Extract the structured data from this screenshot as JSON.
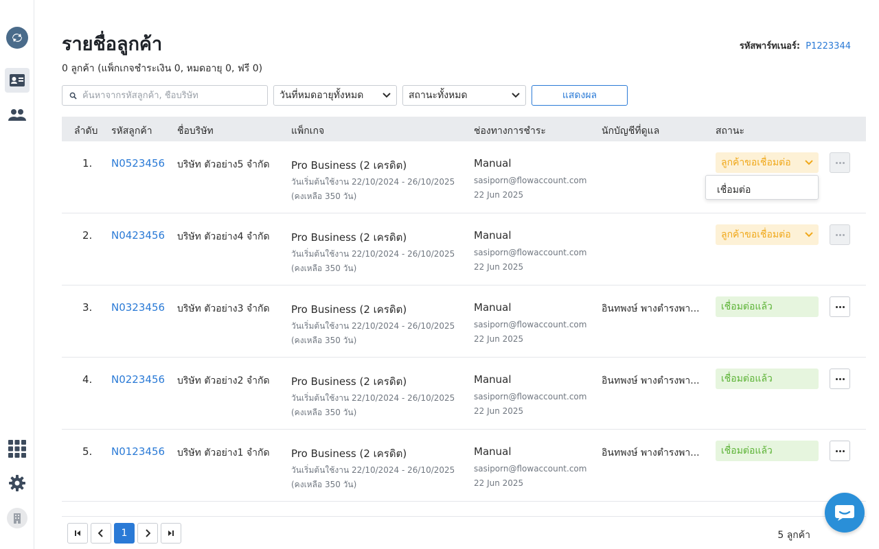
{
  "page": {
    "title": "รายชื่อลูกค้า",
    "subtitle": "0 ลูกค้า (แพ็กเกจชำระเงิน 0, หมดอายุ 0, ฟรี 0)",
    "partner_label": "รหัสพาร์ทเนอร์:",
    "partner_code": "P1223344"
  },
  "filters": {
    "search_placeholder": "ค้นหาจากรหัสลูกค้า, ชื่อบริษัท",
    "expire_select": "วันที่หมดอายุทั้งหมด",
    "status_select": "สถานะทั้งหมด",
    "show_button": "แสดงผล"
  },
  "table": {
    "headers": [
      "ลำดับ",
      "รหัสลูกค้า",
      "ชื่อบริษัท",
      "แพ็กเกจ",
      "ช่องทางการชำระ",
      "นักบัญชีที่ดูแล",
      "สถานะ"
    ],
    "rows": [
      {
        "idx": "1.",
        "code": "N0523456",
        "company": "บริษัท ตัวอย่าง5 จำกัด",
        "package": "Pro Business (2 เครดิต)",
        "dates": "วันเริ่มต้นใช้งาน 22/10/2024 - 26/10/2025",
        "remain": "(คงเหลือ 350 วัน)",
        "payment": "Manual",
        "email": "sasiporn@flowaccount.com",
        "pay_date": "22 Jun 2025",
        "accountant": "",
        "status": "ลูกค้าขอเชื่อมต่อ"
      },
      {
        "idx": "2.",
        "code": "N0423456",
        "company": "บริษัท ตัวอย่าง4 จำกัด",
        "package": "Pro Business (2 เครดิต)",
        "dates": "วันเริ่มต้นใช้งาน 22/10/2024 - 26/10/2025",
        "remain": "(คงเหลือ 350 วัน)",
        "payment": "Manual",
        "email": "sasiporn@flowaccount.com",
        "pay_date": "22 Jun 2025",
        "accountant": "",
        "status": "ลูกค้าขอเชื่อมต่อ"
      },
      {
        "idx": "3.",
        "code": "N0323456",
        "company": "บริษัท ตัวอย่าง3 จำกัด",
        "package": "Pro Business (2 เครดิต)",
        "dates": "วันเริ่มต้นใช้งาน 22/10/2024 - 26/10/2025",
        "remain": "(คงเหลือ 350 วัน)",
        "payment": "Manual",
        "email": "sasiporn@flowaccount.com",
        "pay_date": "22 Jun 2025",
        "accountant": "อินทพงษ์ พางตำรงพา...",
        "status": "เชื่อมต่อแล้ว"
      },
      {
        "idx": "4.",
        "code": "N0223456",
        "company": "บริษัท ตัวอย่าง2 จำกัด",
        "package": "Pro Business (2 เครดิต)",
        "dates": "วันเริ่มต้นใช้งาน 22/10/2024 - 26/10/2025",
        "remain": "(คงเหลือ 350 วัน)",
        "payment": "Manual",
        "email": "sasiporn@flowaccount.com",
        "pay_date": "22 Jun 2025",
        "accountant": "อินทพงษ์ พางตำรงพา...",
        "status": "เชื่อมต่อแล้ว"
      },
      {
        "idx": "5.",
        "code": "N0123456",
        "company": "บริษัท ตัวอย่าง1 จำกัด",
        "package": "Pro Business (2 เครดิต)",
        "dates": "วันเริ่มต้นใช้งาน 22/10/2024 - 26/10/2025",
        "remain": "(คงเหลือ 350 วัน)",
        "payment": "Manual",
        "email": "sasiporn@flowaccount.com",
        "pay_date": "22 Jun 2025",
        "accountant": "อินทพงษ์ พางตำรงพา...",
        "status": "เชื่อมต่อแล้ว"
      }
    ]
  },
  "popup": {
    "connect": "เชื่อมต่อ"
  },
  "pagination": {
    "current": "1",
    "total_label": "5 ลูกค้า"
  },
  "colors": {
    "accent": "#2a7ad6",
    "pending": "#f0a81a",
    "connected": "#5cb336"
  }
}
